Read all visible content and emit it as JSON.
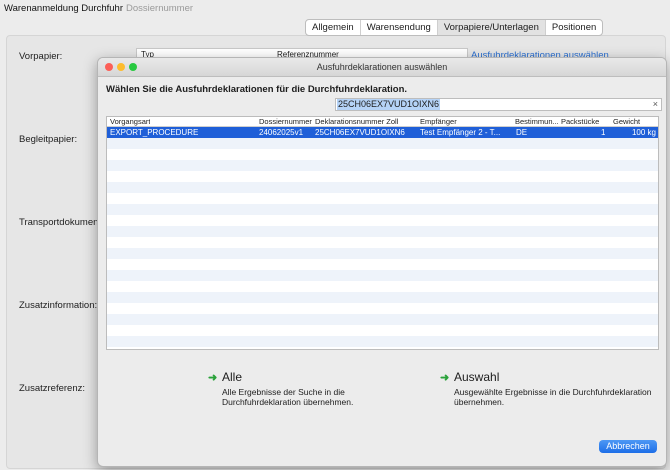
{
  "window": {
    "title": "Warenanmeldung Durchfuhr",
    "subtitle": "Dossiernummer"
  },
  "tabs": [
    {
      "label": "Allgemein"
    },
    {
      "label": "Warensendung"
    },
    {
      "label": "Vorpapiere/Unterlagen"
    },
    {
      "label": "Positionen"
    }
  ],
  "background": {
    "labels": {
      "vorpapier": "Vorpapier:",
      "begleitpapier": "Begleitpapier:",
      "transportdokument": "Transportdokument:",
      "zusatzinformation": "Zusatzinformation:",
      "zusatzreferenz": "Zusatzreferenz:"
    },
    "table_headers": {
      "typ": "Typ",
      "referenznummer": "Referenznummer"
    },
    "link": "Ausfuhrdeklarationen auswählen"
  },
  "dialog": {
    "title": "Ausfuhrdeklarationen auswählen",
    "instruction": "Wählen Sie die Ausfuhrdeklarationen für die Durchfuhrdeklaration.",
    "search_value": "25CH06EX7VUD1OIXN6",
    "clear_symbol": "×",
    "columns": {
      "vorgangsart": "Vorgangsart",
      "dossiernummer": "Dossiernummer",
      "deklarationsnummer": "Deklarationsnummer Zoll",
      "empfaenger": "Empfänger",
      "bestimmung": "Bestimmun...",
      "packstuecke": "Packstücke",
      "gewicht": "Gewicht"
    },
    "rows": [
      {
        "vorgangsart": "EXPORT_PROCEDURE",
        "dossiernummer": "24062025v1",
        "deklarationsnummer": "25CH06EX7VUD1OIXN6",
        "empfaenger": "Test Empfänger 2 - T...",
        "bestimmung": "DE",
        "packstuecke": "1",
        "gewicht": "100 kg"
      }
    ],
    "actions": {
      "alle": {
        "title": "Alle",
        "desc": "Alle Ergebnisse der Suche in die Durchfuhrdeklaration übernehmen."
      },
      "auswahl": {
        "title": "Auswahl",
        "desc": "Ausgewählte Ergebnisse in die Durchfuhrdeklaration übernehmen."
      }
    },
    "cancel_label": "Abbrechen"
  },
  "colors": {
    "accent": "#1f5fd8",
    "arrow": "#2aa23a",
    "link": "#2a6fd1"
  }
}
